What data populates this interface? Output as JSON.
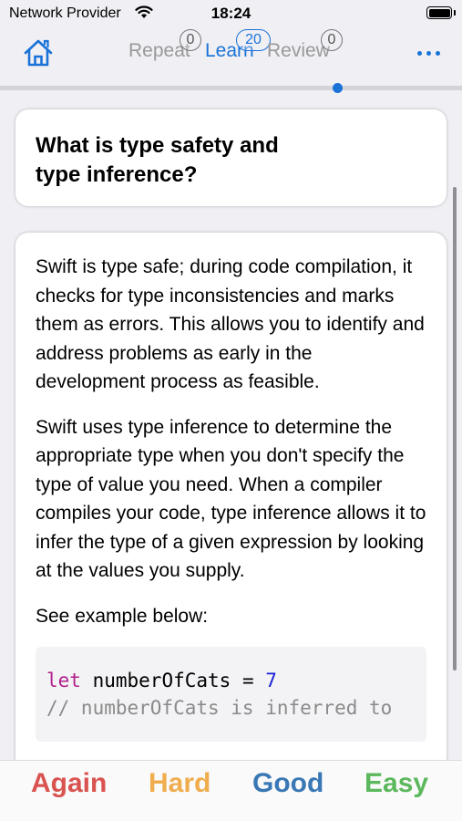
{
  "status_bar": {
    "carrier": "Network Provider",
    "time": "18:24",
    "wifi_icon": "wifi-icon",
    "battery_icon": "battery-icon"
  },
  "nav": {
    "home_icon": "home-icon",
    "more_icon": "ellipsis-icon",
    "accent_color": "#1a73d8",
    "tabs": [
      {
        "label": "Repeat",
        "count": "0"
      },
      {
        "label": "Learn",
        "count": "20"
      },
      {
        "label": "Review",
        "count": "0"
      }
    ],
    "progress": 0.73
  },
  "question": {
    "text": "What is type safety and type inference?"
  },
  "answer": {
    "paragraphs": [
      "Swift is type safe; during code compilation, it checks for type inconsistencies and marks them as errors. This allows you to identify and address problems as early in the development process as feasible.",
      "Swift uses type inference to determine the appropriate type when you don't specify the type of value you need. When a compiler compiles your code, type inference allows it to infer the type of a given expression by looking at the values you supply.",
      "See example below:"
    ],
    "code": {
      "keyword": "let",
      "rest": " numberOfCats = ",
      "number": "7",
      "comment": "// numberOfCats is inferred to"
    }
  },
  "grade_buttons": {
    "again": "Again",
    "hard": "Hard",
    "good": "Good",
    "easy": "Easy",
    "colors": {
      "again": "#d9534f",
      "hard": "#f0ad4e",
      "good": "#3a78b5",
      "easy": "#5cb85c"
    }
  }
}
